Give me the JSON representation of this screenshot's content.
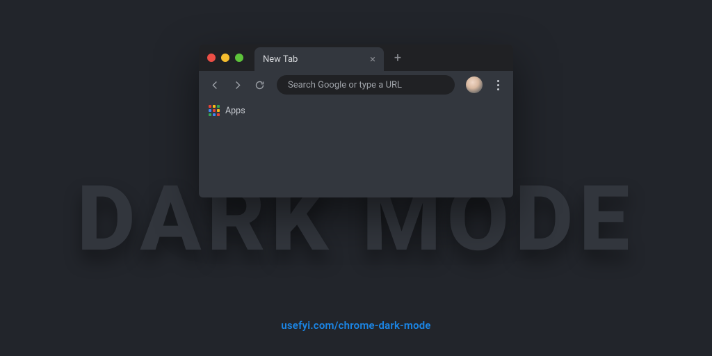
{
  "background_text": "DARK MODE",
  "footer_url": "usefyi.com/chrome-dark-mode",
  "browser": {
    "tab": {
      "title": "New Tab",
      "close_symbol": "×"
    },
    "new_tab_symbol": "+",
    "omnibox_placeholder": "Search Google or type a URL",
    "bookmarks": {
      "apps_label": "Apps"
    }
  },
  "colors": {
    "page_bg": "#22252b",
    "browser_bg": "#33373e",
    "tabstrip_bg": "#202124",
    "big_text": "#32363d",
    "link": "#1b86e6",
    "traffic_red": "#ec4f46",
    "traffic_yellow": "#f5bd2e",
    "traffic_green": "#5ec43b"
  }
}
